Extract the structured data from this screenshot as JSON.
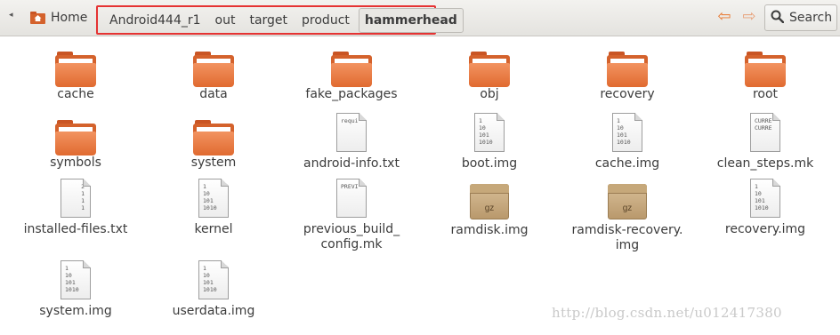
{
  "toolbar": {
    "home_label": "Home",
    "breadcrumbs": [
      "Android444_r1",
      "out",
      "target",
      "product"
    ],
    "current_folder": "hammerhead",
    "search_label": "Search",
    "icons": {
      "back": "left-arrow-icon",
      "forward": "right-arrow-icon",
      "search": "search-icon",
      "home": "home-folder-icon"
    },
    "highlight_color": "#e53333"
  },
  "files": [
    {
      "name": "cache",
      "type": "folder"
    },
    {
      "name": "data",
      "type": "folder"
    },
    {
      "name": "fake_packages",
      "type": "folder"
    },
    {
      "name": "obj",
      "type": "folder"
    },
    {
      "name": "recovery",
      "type": "folder"
    },
    {
      "name": "root",
      "type": "folder"
    },
    {
      "name": "symbols",
      "type": "folder"
    },
    {
      "name": "system",
      "type": "folder"
    },
    {
      "name": "android-info.txt",
      "type": "text",
      "preview": "requi"
    },
    {
      "name": "boot.img",
      "type": "binary",
      "preview": "1\n10\n101\n1010"
    },
    {
      "name": "cache.img",
      "type": "binary",
      "preview": "1\n10\n101\n1010"
    },
    {
      "name": "clean_steps.mk",
      "type": "text",
      "preview": "CURRE\nCURRE"
    },
    {
      "name": "installed-files.txt",
      "type": "text-right",
      "preview": "2\n1\n1\n1"
    },
    {
      "name": "kernel",
      "type": "binary",
      "preview": "1\n10\n101\n1010"
    },
    {
      "name": "previous_build_\nconfig.mk",
      "type": "text",
      "preview": "PREVI"
    },
    {
      "name": "ramdisk.img",
      "type": "gz",
      "preview": "gz"
    },
    {
      "name": "ramdisk-recovery.\nimg",
      "type": "gz",
      "preview": "gz"
    },
    {
      "name": "recovery.img",
      "type": "binary",
      "preview": "1\n10\n101\n1010"
    },
    {
      "name": "system.img",
      "type": "binary",
      "preview": "1\n10\n101\n1010"
    },
    {
      "name": "userdata.img",
      "type": "binary",
      "preview": "1\n10\n101\n1010"
    }
  ],
  "watermark": "http://blog.csdn.net/u012417380"
}
